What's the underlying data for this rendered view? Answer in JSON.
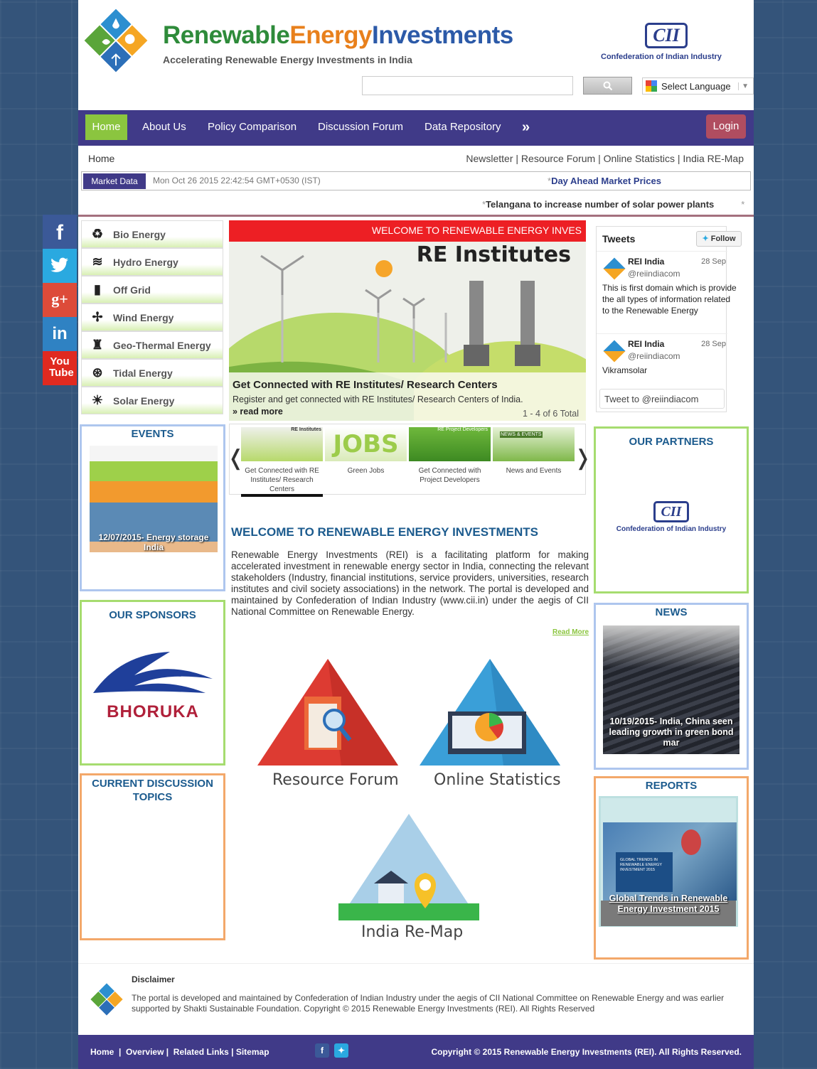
{
  "header": {
    "title_1": "Renewable",
    "title_2": "Energy",
    "title_3": "Investments",
    "tagline": "Accelerating Renewable Energy Investments in India",
    "cii_logo": "CII",
    "cii_name": "Confederation of Indian Industry",
    "search_placeholder": "",
    "language": "Select Language"
  },
  "nav": {
    "items": [
      "Home",
      "About Us",
      "Policy Comparison",
      "Discussion Forum",
      "Data Repository"
    ],
    "more": "»",
    "login": "Login"
  },
  "breadcrumb": {
    "current": "Home",
    "links": [
      "Newsletter",
      "Resource Forum",
      "Online Statistics",
      "India RE-Map"
    ]
  },
  "market": {
    "label": "Market Data",
    "datetime": "Mon Oct 26 2015 22:42:54 GMT+0530 (IST)",
    "link": "Day Ahead Market Prices"
  },
  "ticker": "Telangana to increase number of solar power plants",
  "energy_menu": [
    {
      "label": "Bio Energy",
      "icon": "recycle-icon"
    },
    {
      "label": "Hydro Energy",
      "icon": "water-icon"
    },
    {
      "label": "Off Grid",
      "icon": "battery-icon"
    },
    {
      "label": "Wind Energy",
      "icon": "wind-turbine-icon"
    },
    {
      "label": "Geo-Thermal Energy",
      "icon": "geothermal-icon"
    },
    {
      "label": "Tidal Energy",
      "icon": "tidal-icon"
    },
    {
      "label": "Solar Energy",
      "icon": "sun-icon"
    }
  ],
  "slider": {
    "banner": "WELCOME TO RENEWABLE ENERGY INVES",
    "heading": "RE Institutes",
    "caption_title": "Get Connected with RE Institutes/ Research Centers",
    "caption_text": "Register and get connected with RE Institutes/ Research Centers of India.",
    "read_more": "» read more",
    "count": "1 - 4 of 6 Total"
  },
  "thumbs": [
    {
      "label": "Get Connected with RE Institutes/ Research Centers",
      "overlay": "RE Institutes"
    },
    {
      "label": "Green Jobs",
      "overlay": "JOBS"
    },
    {
      "label": "Get Connected with Project Developers",
      "overlay": "RE Project Developers"
    },
    {
      "label": "News and Events",
      "overlay": "NEWS & EVENTS"
    }
  ],
  "events": {
    "title": "EVENTS",
    "caption": "12/07/2015- Energy storage India"
  },
  "sponsors": {
    "title": "OUR SPONSORS",
    "sponsor": "BHORUKA"
  },
  "discussion": {
    "title": "CURRENT DISCUSSION TOPICS"
  },
  "welcome": {
    "title": "WELCOME TO RENEWABLE ENERGY INVESTMENTS",
    "text": "Renewable Energy Investments (REI) is a facilitating platform for making accelerated investment in renewable energy sector in India, connecting the relevant stakeholders (Industry, financial institutions, service providers, universities, research institutes and civil society associations) in the network. The portal is developed and maintained by Confederation of Indian Industry (www.cii.in) under the aegis of CII National Committee on Renewable Energy.",
    "read_more": "Read More"
  },
  "features": {
    "resource": "Resource Forum",
    "stats": "Online Statistics",
    "remap": "India Re-Map"
  },
  "tweets": {
    "title": "Tweets",
    "follow": "Follow",
    "items": [
      {
        "name": "REI India",
        "handle": "@reiindiacom",
        "date": "28 Sep",
        "text": "This is first domain which is provide the all types of information related to the Renewable Energy"
      },
      {
        "name": "REI India",
        "handle": "@reiindiacom",
        "date": "28 Sep",
        "text": "Vikramsolar"
      }
    ],
    "input": "Tweet to @reiindiacom"
  },
  "partners": {
    "title": "OUR PARTNERS",
    "logo": "CII",
    "name": "Confederation of Indian Industry"
  },
  "news": {
    "title": "NEWS",
    "caption": "10/19/2015- India, China seen leading growth in green bond mar"
  },
  "reports": {
    "title": "REPORTS",
    "caption": "Global Trends in Renewable Energy Investment 2015",
    "cover": "GLOBAL TRENDS IN RENEWABLE ENERGY INVESTMENT 2015"
  },
  "social": [
    {
      "label": "f",
      "icon": "facebook-icon",
      "color": "#3b5998"
    },
    {
      "label": "",
      "icon": "twitter-icon",
      "color": "#2aa9e0"
    },
    {
      "label": "g+",
      "icon": "google-plus-icon",
      "color": "#dd4b39"
    },
    {
      "label": "in",
      "icon": "linkedin-icon",
      "color": "#2f82c3"
    },
    {
      "label": "You Tube",
      "icon": "youtube-icon",
      "color": "#e02a20"
    }
  ],
  "footer": {
    "disclaimer_title": "Disclaimer",
    "disclaimer": "The portal is developed and maintained by Confederation of Indian Industry under the aegis of CII National Committee on Renewable Energy and was earlier supported by Shakti Sustainable Foundation. Copyright © 2015 Renewable Energy Investments (REI). All Rights Reserved",
    "links": [
      "Home",
      "Overview",
      "Related Links",
      "Sitemap"
    ],
    "copyright": "Copyright © 2015 Renewable Energy Investments (REI). All Rights Reserved."
  }
}
